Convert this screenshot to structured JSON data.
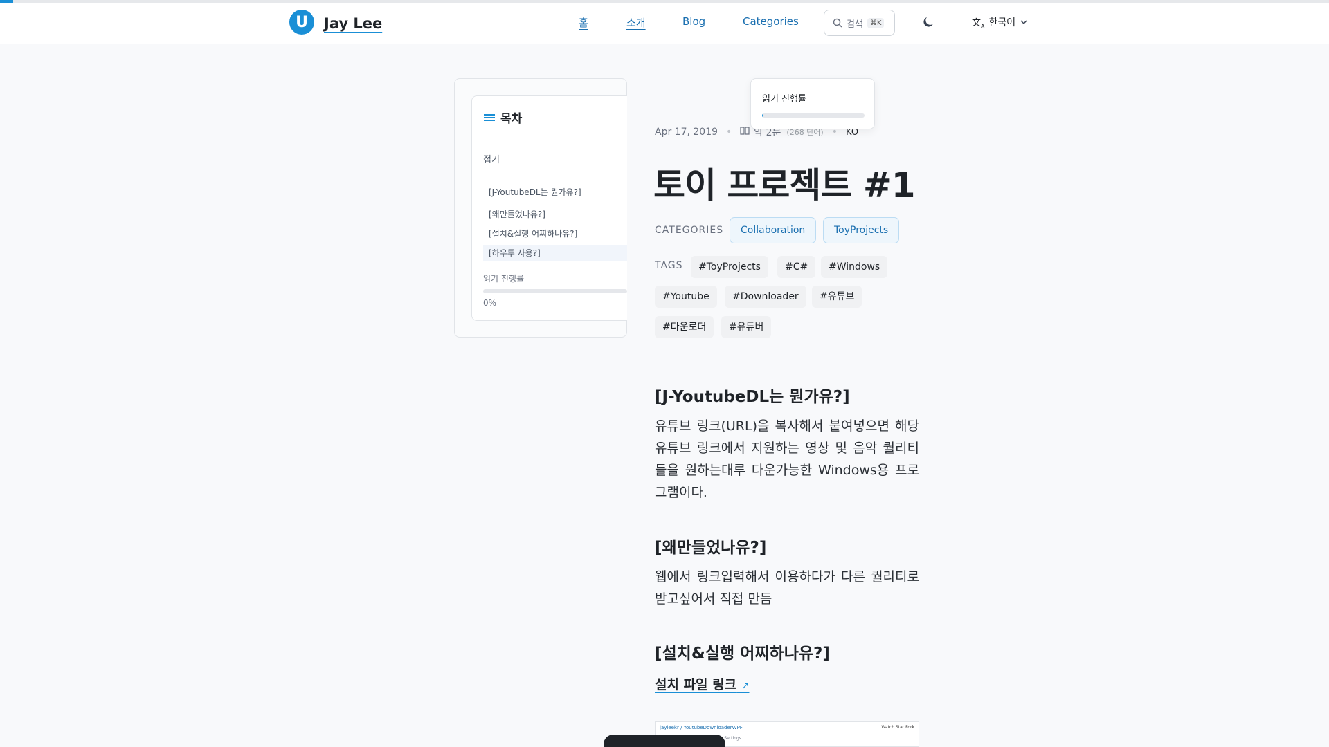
{
  "reading_progress_top": 0.01,
  "header": {
    "logo_letter": "U",
    "brand": "Jay Lee",
    "nav": [
      "홈",
      "소개",
      "Blog",
      "Categories"
    ],
    "search_placeholder": "검색",
    "search_shortcut": "⌘K",
    "theme_icon": "moon-icon",
    "language": "한국어"
  },
  "toc": {
    "title": "목차",
    "fold_label": "접기",
    "items": [
      "[J-YoutubeDL는 뭔가유?]",
      "[왜만들었나유?]",
      "[설치&실행 어찌하나유?]",
      "[하우투 사용?]"
    ],
    "active_index": 3,
    "progress_label": "읽기 진행률",
    "progress_value": "0%",
    "progress_fraction": 0
  },
  "floating_progress": {
    "label": "읽기 진행률",
    "fraction": 0.01
  },
  "post": {
    "date": "Apr 17, 2019",
    "read_time": "약 2분",
    "word_count": "(268 단어)",
    "lang": "KO",
    "title": "토이 프로젝트 #1",
    "categories_label": "CATEGORIES",
    "categories": [
      "Collaboration",
      "ToyProjects"
    ],
    "tags_label": "TAGS",
    "tags": [
      "#ToyProjects",
      "#C#",
      "#Windows",
      "#Youtube",
      "#Downloader",
      "#유튜브",
      "#다운로더",
      "#유튜버"
    ],
    "sections": [
      {
        "heading": "[J-YoutubeDL는 뭔가유?]",
        "body": "유튜브 링크(URL)을 복사해서 붙여넣으면 해당 유튜브 링크에서 지원하는 영상 및 음악 퀄리티들을 원하는대루 다운가능한 Windows용 프로그램이다."
      },
      {
        "heading": "[왜만들었나유?]",
        "body": "웹에서 링크입력해서 이용하다가 다른 퀄리티로 받고싶어서 직접 만듬"
      },
      {
        "heading": "[설치&실행 어찌하나유?]",
        "body": ""
      }
    ],
    "install_link": "설치 파일 링크",
    "install_link_icon": "external-link-icon",
    "screenshot_repo": "jayleekr / YoutubeDownloaderWPF",
    "screenshot_tabs": "requests  Projects  Wiki  Insights  Settings",
    "screenshot_buttons": "Watch  Star  Fork"
  },
  "colors": {
    "accent": "#1a8fd6",
    "link": "#1a6fb0",
    "chip_bg": "#eef6fc",
    "tag_bg": "#f0f1f3"
  }
}
